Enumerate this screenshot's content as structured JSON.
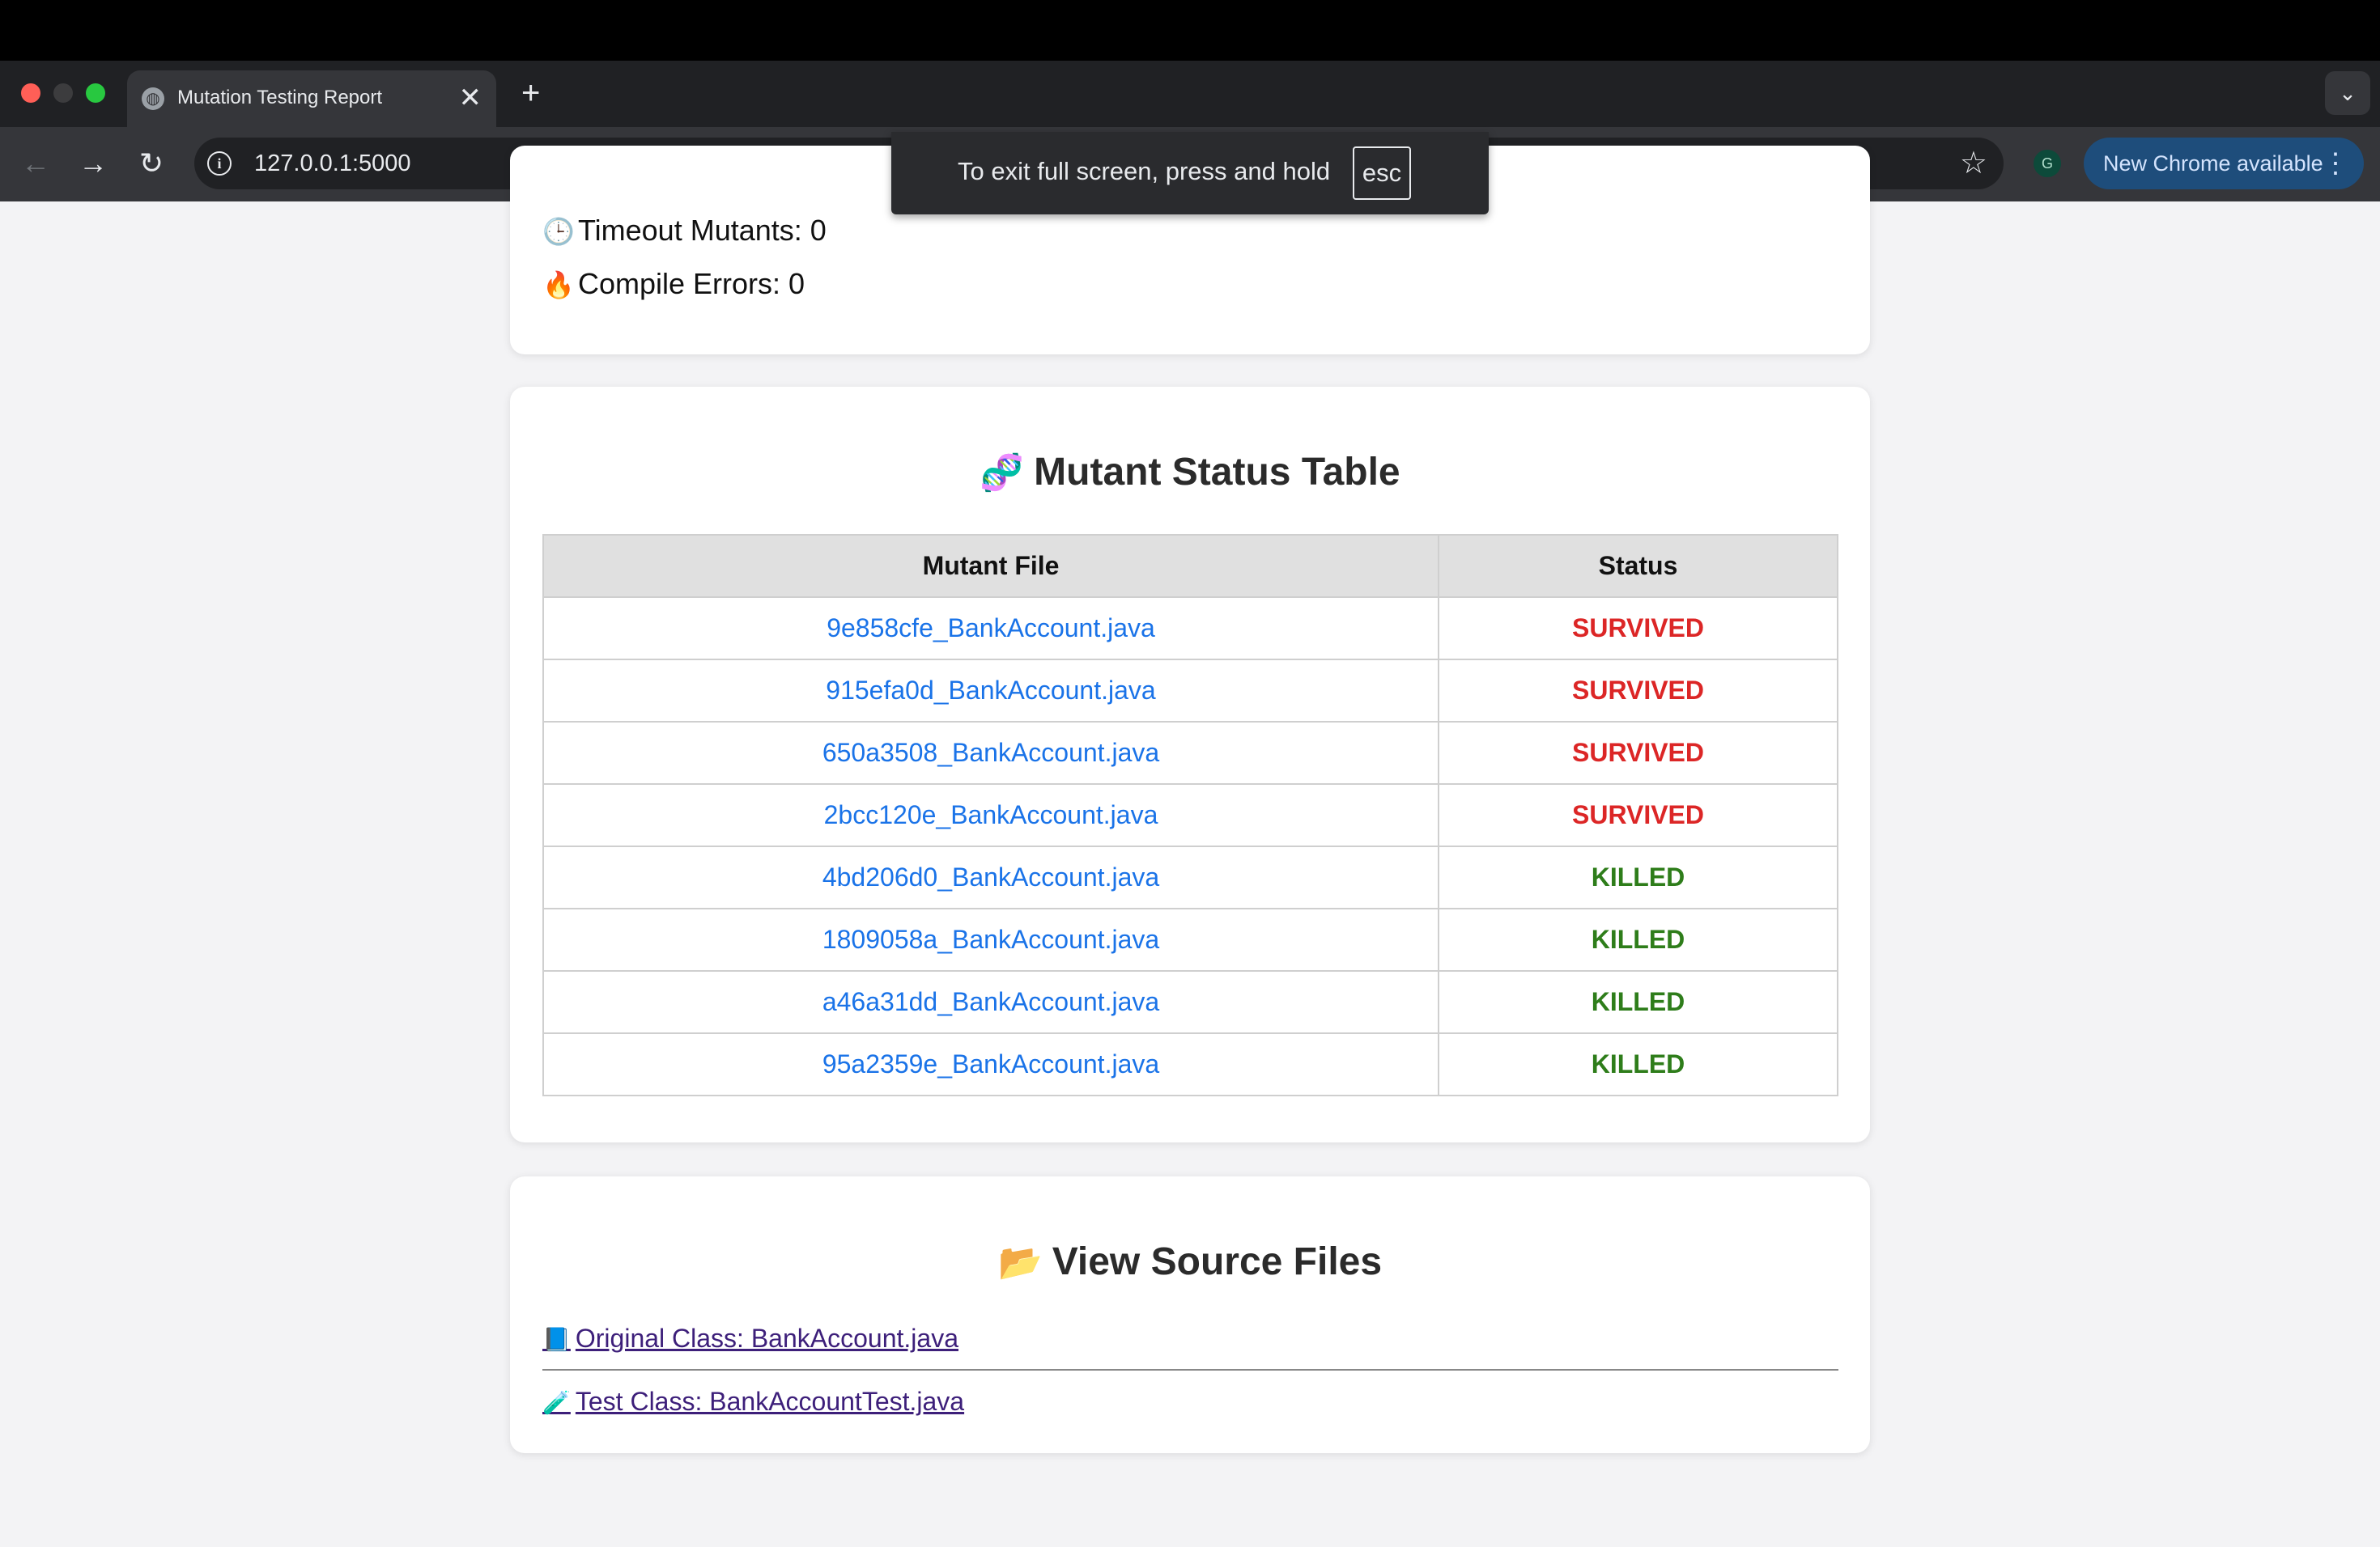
{
  "browser": {
    "tab_title": "Mutation Testing Report",
    "new_tab_glyph": "+",
    "tab_close_glyph": "✕",
    "url": "127.0.0.1:5000",
    "profile_initial": "G",
    "update_label": "New Chrome available",
    "fullscreen_message": "To exit full screen, press and hold",
    "fullscreen_key": "esc",
    "icons": [
      "globe-icon",
      "back-arrow-icon",
      "forward-arrow-icon",
      "reload-icon",
      "site-info-icon",
      "bookmark-star-icon",
      "kebab-menu-icon",
      "tab-search-chevron-icon"
    ]
  },
  "summary": {
    "timeout_label": "Timeout Mutants: 0",
    "timeout_emoji": "🕒",
    "compile_label": "Compile Errors: 0",
    "compile_emoji": "🔥"
  },
  "mutant_table": {
    "title": "Mutant Status Table",
    "title_emoji": "🧬",
    "columns": [
      "Mutant File",
      "Status"
    ],
    "rows": [
      {
        "file": "9e858cfe_BankAccount.java",
        "status": "SURVIVED"
      },
      {
        "file": "915efa0d_BankAccount.java",
        "status": "SURVIVED"
      },
      {
        "file": "650a3508_BankAccount.java",
        "status": "SURVIVED"
      },
      {
        "file": "2bcc120e_BankAccount.java",
        "status": "SURVIVED"
      },
      {
        "file": "4bd206d0_BankAccount.java",
        "status": "KILLED"
      },
      {
        "file": "1809058a_BankAccount.java",
        "status": "KILLED"
      },
      {
        "file": "a46a31dd_BankAccount.java",
        "status": "KILLED"
      },
      {
        "file": "95a2359e_BankAccount.java",
        "status": "KILLED"
      }
    ],
    "status_colors": {
      "SURVIVED": "#dc2626",
      "KILLED": "#2e7d1a"
    }
  },
  "source_files": {
    "title": "View Source Files",
    "title_emoji": "📂",
    "original_label": "Original Class: BankAccount.java",
    "original_emoji": "📘",
    "test_label": "Test Class: BankAccountTest.java",
    "test_emoji": "🧪"
  },
  "colors": {
    "link": "#1a73e8",
    "visited_link": "#3d1f7a",
    "page_background": "#f3f3f5"
  }
}
